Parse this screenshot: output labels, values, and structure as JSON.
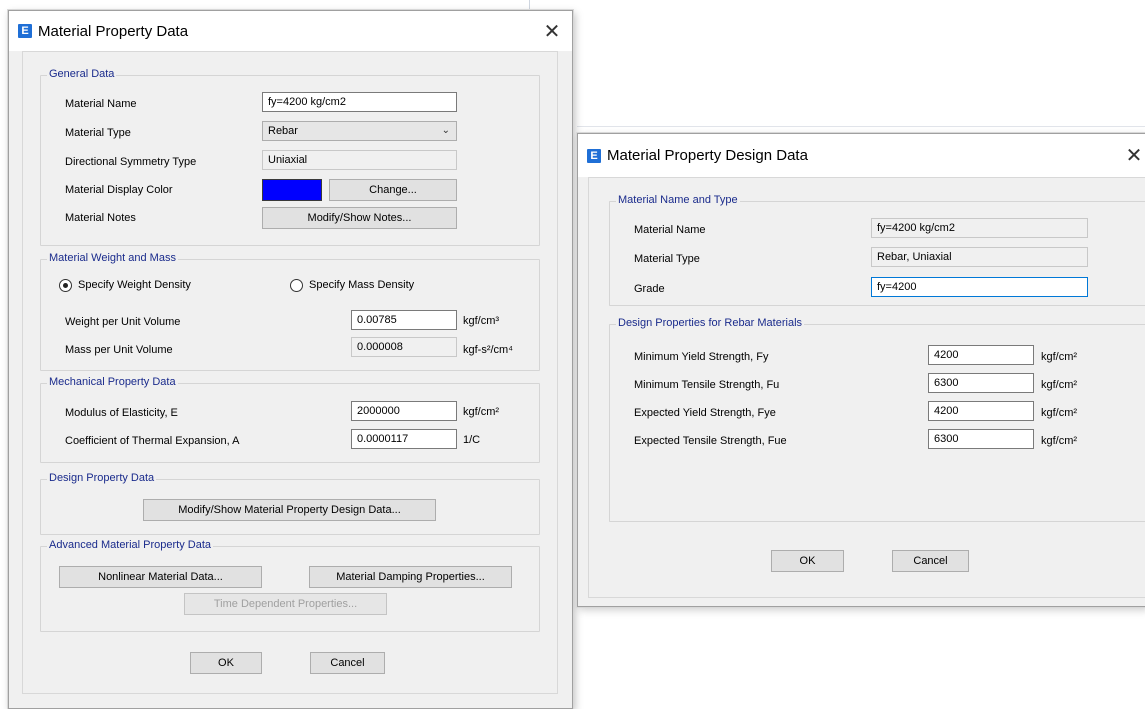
{
  "left_dialog": {
    "title": "Material Property Data",
    "app_icon": "E",
    "general": {
      "title": "General Data",
      "material_name_label": "Material Name",
      "material_name_value": "fy=4200 kg/cm2",
      "material_type_label": "Material Type",
      "material_type_value": "Rebar",
      "symmetry_label": "Directional Symmetry Type",
      "symmetry_value": "Uniaxial",
      "display_color_label": "Material Display Color",
      "display_color_value": "#0000ff",
      "change_button": "Change...",
      "notes_label": "Material Notes",
      "notes_button": "Modify/Show Notes..."
    },
    "weight_mass": {
      "title": "Material Weight and Mass",
      "weight_density_option": "Specify Weight Density",
      "mass_density_option": "Specify Mass Density",
      "selected_option": "weight",
      "weight_label": "Weight per Unit Volume",
      "weight_value": "0.00785",
      "weight_unit": "kgf/cm³",
      "mass_label": "Mass per Unit Volume",
      "mass_value": "0.000008",
      "mass_unit": "kgf-s²/cm⁴"
    },
    "mechanical": {
      "title": "Mechanical Property Data",
      "modulus_label": "Modulus of Elasticity,  E",
      "modulus_value": "2000000",
      "modulus_unit": "kgf/cm²",
      "thermal_label": "Coefficient of Thermal Expansion,  A",
      "thermal_value": "0.0000117",
      "thermal_unit": "1/C"
    },
    "design": {
      "title": "Design Property Data",
      "button": "Modify/Show Material Property Design Data..."
    },
    "advanced": {
      "title": "Advanced Material Property Data",
      "nonlinear_button": "Nonlinear Material Data...",
      "damping_button": "Material Damping Properties...",
      "time_dependent_button": "Time Dependent Properties..."
    },
    "ok_button": "OK",
    "cancel_button": "Cancel"
  },
  "right_dialog": {
    "title": "Material Property Design Data",
    "app_icon": "E",
    "name_type": {
      "title": "Material Name and Type",
      "name_label": "Material Name",
      "name_value": "fy=4200 kg/cm2",
      "type_label": "Material Type",
      "type_value": "Rebar, Uniaxial",
      "grade_label": "Grade",
      "grade_value": "fy=4200"
    },
    "rebar": {
      "title": "Design Properties for Rebar Materials",
      "rows": [
        {
          "label": "Minimum Yield Strength, Fy",
          "value": "4200",
          "unit": "kgf/cm²"
        },
        {
          "label": "Minimum Tensile Strength, Fu",
          "value": "6300",
          "unit": "kgf/cm²"
        },
        {
          "label": "Expected Yield Strength, Fye",
          "value": "4200",
          "unit": "kgf/cm²"
        },
        {
          "label": "Expected Tensile Strength, Fue",
          "value": "6300",
          "unit": "kgf/cm²"
        }
      ]
    },
    "ok_button": "OK",
    "cancel_button": "Cancel"
  },
  "icons": {
    "close": "close-icon",
    "dropdown": "chevron-down-icon",
    "app": "etabs-app-icon"
  }
}
